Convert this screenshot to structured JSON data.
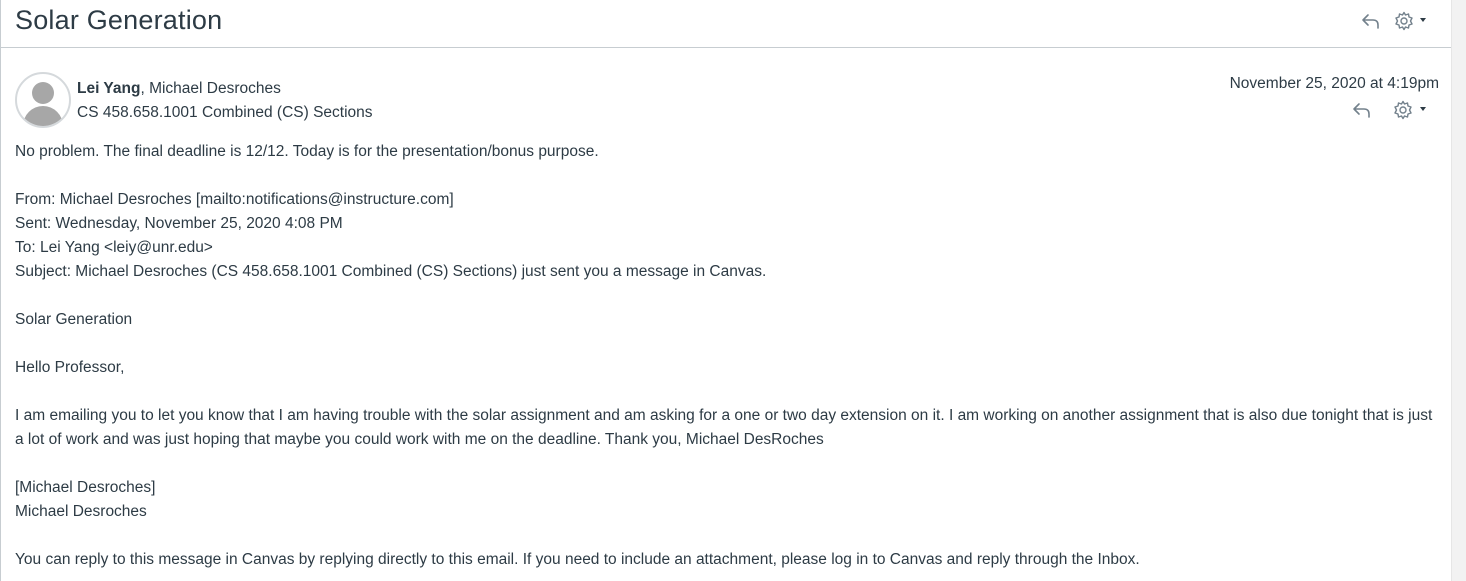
{
  "conversation": {
    "subject": "Solar Generation"
  },
  "message": {
    "author": "Lei Yang",
    "participants_rest": ", Michael Desroches",
    "course": "CS 458.658.1001 Combined (CS) Sections",
    "date": "November 25, 2020 at 4:19pm",
    "body": {
      "reply_line": "No problem. The final deadline is 12/12. Today is for the presentation/bonus purpose.",
      "from_line": "From: Michael Desroches [mailto:notifications@instructure.com]",
      "sent_line": "Sent: Wednesday, November 25, 2020 4:08 PM",
      "to_line": "To: Lei Yang <leiy@unr.edu>",
      "subject_line": "Subject: Michael Desroches (CS 458.658.1001 Combined (CS) Sections) just sent you a message in Canvas.",
      "quoted_subject": "Solar Generation",
      "greeting": "Hello Professor,",
      "paragraph": "I am emailing you to let you know that I am having trouble with the solar assignment and am asking for a one or two day extension on it. I am working on another assignment that is also due tonight that is just a lot of work and was just hoping that maybe you could work with me on the deadline. Thank you, Michael DesRoches",
      "signature_bracket": "[Michael Desroches]",
      "signature_name": "Michael Desroches",
      "footer": "You can reply to this message in Canvas by replying directly to this email. If you need to include an attachment, please log in to Canvas and reply through the Inbox."
    }
  },
  "icons": {
    "reply": "reply-icon",
    "settings": "gear-icon",
    "menu": "caret-down-icon"
  },
  "colors": {
    "text": "#2d3b45",
    "icon": "#73818c",
    "divider": "#c7cdd1"
  }
}
